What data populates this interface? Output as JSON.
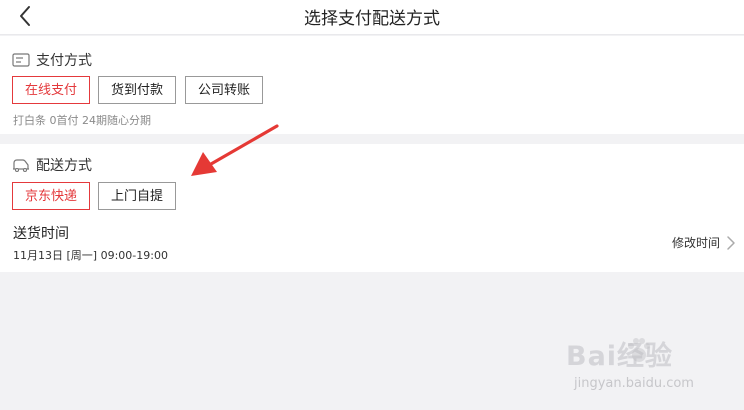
{
  "header": {
    "title": "选择支付配送方式",
    "back_icon": "chevron-left-icon"
  },
  "payment": {
    "section_title": "支付方式",
    "section_icon": "card-icon",
    "options": [
      {
        "label": "在线支付",
        "selected": true
      },
      {
        "label": "货到付款",
        "selected": false
      },
      {
        "label": "公司转账",
        "selected": false
      }
    ],
    "hint": "打白条 0首付 24期随心分期"
  },
  "delivery": {
    "section_title": "配送方式",
    "section_icon": "truck-icon",
    "options": [
      {
        "label": "京东快递",
        "selected": true
      },
      {
        "label": "上门自提",
        "selected": false
      }
    ],
    "time_label": "送货时间",
    "time_value": "11月13日 [周一] 09:00-19:00",
    "modify_label": "修改时间",
    "modify_icon": "chevron-right-icon"
  },
  "annotation": {
    "arrow_icon": "red-arrow-icon",
    "arrow_color": "#e53935"
  },
  "watermark": {
    "main": "Bai经验",
    "sub": "jingyan.baidu.com",
    "icon": "baidu-paw-icon"
  },
  "colors": {
    "accent": "#e4393c",
    "background": "#f2f2f4",
    "card": "#ffffff"
  }
}
